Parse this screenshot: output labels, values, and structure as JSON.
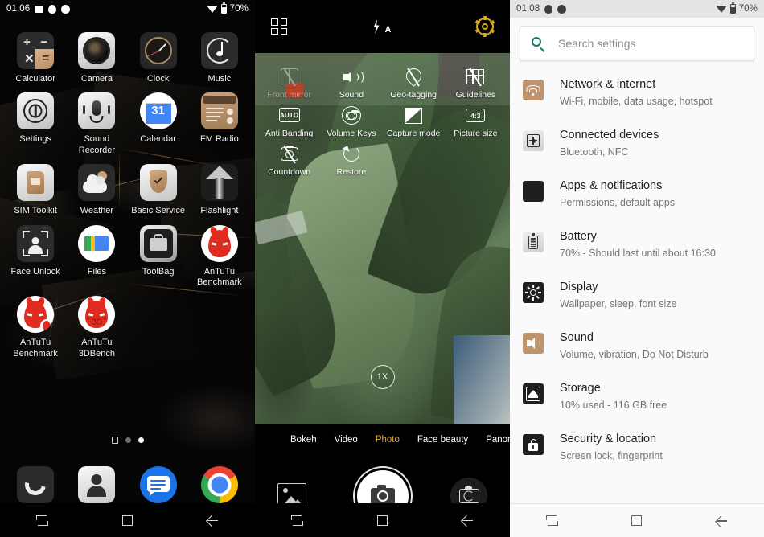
{
  "home": {
    "statusbar": {
      "time": "01:06",
      "battery_pct": "70%",
      "icons": [
        "gallery-icon",
        "blob-icon",
        "blob-icon-2",
        "wifi-icon",
        "battery-icon"
      ]
    },
    "apps": [
      [
        {
          "label": "Calculator",
          "icon": "calculator-icon"
        },
        {
          "label": "Camera",
          "icon": "camera-icon"
        },
        {
          "label": "Clock",
          "icon": "clock-icon"
        },
        {
          "label": "Music",
          "icon": "music-icon"
        }
      ],
      [
        {
          "label": "Settings",
          "icon": "settings-icon"
        },
        {
          "label": "Sound Recorder",
          "icon": "sound-recorder-icon"
        },
        {
          "label": "Calendar",
          "icon": "calendar-icon",
          "day": "31"
        },
        {
          "label": "FM Radio",
          "icon": "fm-radio-icon"
        }
      ],
      [
        {
          "label": "SIM Toolkit",
          "icon": "sim-toolkit-icon"
        },
        {
          "label": "Weather",
          "icon": "weather-icon"
        },
        {
          "label": "Basic Service",
          "icon": "basic-service-icon"
        },
        {
          "label": "Flashlight",
          "icon": "flashlight-icon"
        }
      ],
      [
        {
          "label": "Face Unlock",
          "icon": "face-unlock-icon"
        },
        {
          "label": "Files",
          "icon": "files-icon"
        },
        {
          "label": "ToolBag",
          "icon": "toolbag-icon"
        },
        {
          "label": "AnTuTu Benchmark",
          "icon": "antutu-icon"
        }
      ],
      [
        {
          "label": "AnTuTu Benchmark",
          "icon": "antutu-icon"
        },
        {
          "label": "AnTuTu 3DBench",
          "icon": "antutu-3d-icon",
          "badge": "3D"
        }
      ]
    ],
    "dock": [
      {
        "label": "Phone",
        "icon": "phone-icon"
      },
      {
        "label": "Contacts",
        "icon": "contacts-icon"
      },
      {
        "label": "Messages",
        "icon": "messages-icon"
      },
      {
        "label": "Chrome",
        "icon": "chrome-icon"
      }
    ],
    "page_indicator": {
      "pages": 2,
      "active": 2
    },
    "navbar": [
      "recents-icon",
      "home-icon",
      "back-icon"
    ]
  },
  "camera": {
    "topbar": {
      "grid": "grid-mode-icon",
      "flash": "flash-auto-icon",
      "flash_label": "A",
      "settings": "gear-icon",
      "settings_color": "#d8a81d"
    },
    "settings_overlay": [
      [
        {
          "label": "Front mirror",
          "icon": "front-mirror-off-icon",
          "enabled": false
        },
        {
          "label": "Sound",
          "icon": "sound-icon",
          "enabled": true
        },
        {
          "label": "Geo-tagging",
          "icon": "geo-tagging-off-icon",
          "enabled": true
        },
        {
          "label": "Guidelines",
          "icon": "guidelines-icon",
          "enabled": true
        }
      ],
      [
        {
          "label": "Anti Banding",
          "icon": "anti-banding-auto-icon",
          "enabled": true,
          "value": "AUTO"
        },
        {
          "label": "Volume Keys",
          "icon": "volume-keys-icon",
          "enabled": true
        },
        {
          "label": "Capture mode",
          "icon": "capture-mode-icon",
          "enabled": true
        },
        {
          "label": "Picture size",
          "icon": "picture-size-icon",
          "enabled": true,
          "value": "4:3"
        }
      ],
      [
        {
          "label": "Countdown",
          "icon": "countdown-off-icon",
          "enabled": true
        },
        {
          "label": "Restore",
          "icon": "restore-icon",
          "enabled": true
        }
      ]
    ],
    "zoom_badge": "1X",
    "modes": [
      {
        "label": "Bokeh",
        "active": false
      },
      {
        "label": "Video",
        "active": false
      },
      {
        "label": "Photo",
        "active": true
      },
      {
        "label": "Face beauty",
        "active": false
      },
      {
        "label": "Panorama",
        "active": false
      }
    ],
    "active_mode_color": "#e0a818",
    "controls": {
      "gallery": "gallery-thumbnail-button",
      "shutter": "shutter-button",
      "switch": "switch-camera-button"
    },
    "navbar": [
      "recents-icon",
      "home-icon",
      "back-icon"
    ]
  },
  "settings": {
    "statusbar": {
      "time": "01:08",
      "battery_pct": "70%"
    },
    "search": {
      "placeholder": "Search settings",
      "icon": "search-icon",
      "icon_color": "#0f7a6c"
    },
    "items": [
      {
        "title": "Network & internet",
        "subtitle": "Wi-Fi, mobile, data usage, hotspot",
        "icon": "wifi-icon",
        "bg": "#bd946d"
      },
      {
        "title": "Connected devices",
        "subtitle": "Bluetooth, NFC",
        "icon": "connected-devices-icon",
        "bg": "#dcdcdc"
      },
      {
        "title": "Apps & notifications",
        "subtitle": "Permissions, default apps",
        "icon": "apps-icon",
        "bg": "#1f1f1f"
      },
      {
        "title": "Battery",
        "subtitle": "70% - Should last until about 16:30",
        "icon": "battery-icon",
        "bg": "#dcdcdc"
      },
      {
        "title": "Display",
        "subtitle": "Wallpaper, sleep, font size",
        "icon": "display-icon",
        "bg": "#1f1f1f"
      },
      {
        "title": "Sound",
        "subtitle": "Volume, vibration, Do Not Disturb",
        "icon": "sound-icon",
        "bg": "#bd946d"
      },
      {
        "title": "Storage",
        "subtitle": "10% used - 116 GB free",
        "icon": "storage-icon",
        "bg": "#1f1f1f"
      },
      {
        "title": "Security & location",
        "subtitle": "Screen lock, fingerprint",
        "icon": "security-icon",
        "bg": "#1f1f1f"
      }
    ],
    "navbar": [
      "recents-icon",
      "home-icon",
      "back-icon"
    ]
  }
}
